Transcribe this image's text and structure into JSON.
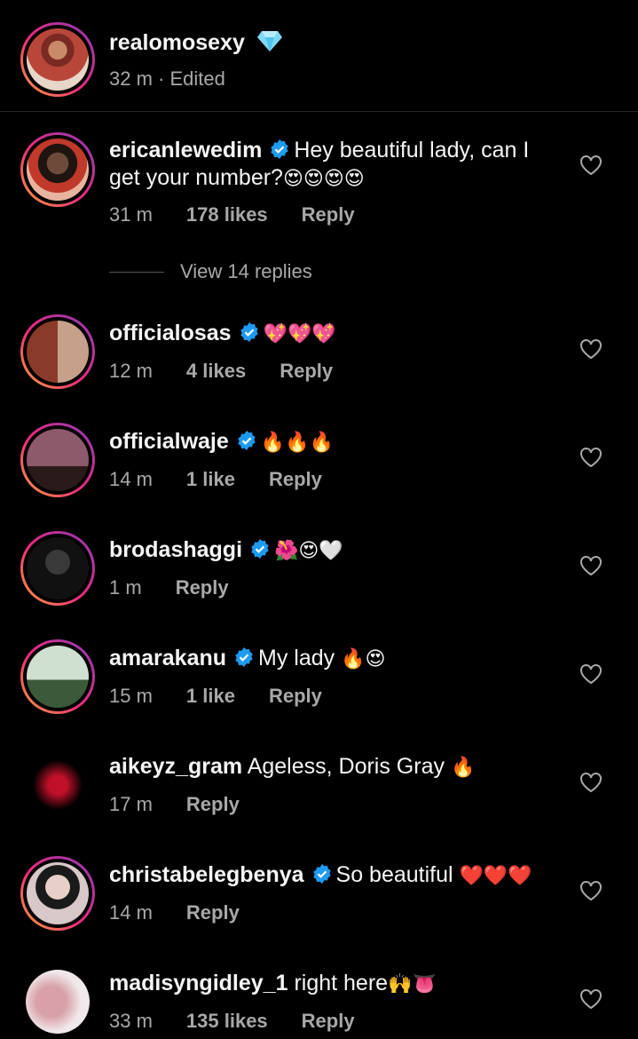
{
  "caption": {
    "username": "realomosexy",
    "badge_icon": "diamond-icon",
    "time": "32 m",
    "edited": "Edited"
  },
  "comments": [
    {
      "username": "ericanlewedim",
      "verified": true,
      "text": "Hey beautiful lady, can I get your number?",
      "emoji": "😍😍😍😍",
      "time": "31 m",
      "likes": "178 likes",
      "reply": "Reply",
      "view_replies": "View 14 replies"
    },
    {
      "username": "officialosas",
      "verified": true,
      "text": "",
      "emoji": "💖💖💖",
      "time": "12 m",
      "likes": "4 likes",
      "reply": "Reply"
    },
    {
      "username": "officialwaje",
      "verified": true,
      "text": "",
      "emoji": "🔥🔥🔥",
      "time": "14 m",
      "likes": "1 like",
      "reply": "Reply"
    },
    {
      "username": "brodashaggi",
      "verified": true,
      "text": "",
      "emoji": "🌺😍🤍",
      "time": "1 m",
      "likes": "",
      "reply": "Reply"
    },
    {
      "username": "amarakanu",
      "verified": true,
      "text": "My lady",
      "emoji": "🔥😍",
      "time": "15 m",
      "likes": "1 like",
      "reply": "Reply"
    },
    {
      "username": "aikeyz_gram",
      "verified": false,
      "text": "Ageless, Doris Gray",
      "emoji": "🔥",
      "time": "17 m",
      "likes": "",
      "reply": "Reply"
    },
    {
      "username": "christabelegbenya",
      "verified": true,
      "text": "So beautiful",
      "emoji": "❤️❤️❤️",
      "time": "14 m",
      "likes": "",
      "reply": "Reply"
    },
    {
      "username": "madisyngidley_1",
      "verified": false,
      "text": "right here",
      "emoji": "🙌👅",
      "time": "33 m",
      "likes": "135 likes",
      "reply": "Reply"
    }
  ],
  "colors": {
    "verified": "#1d9bf0",
    "meta": "#a8a8a8",
    "background": "#000000"
  }
}
